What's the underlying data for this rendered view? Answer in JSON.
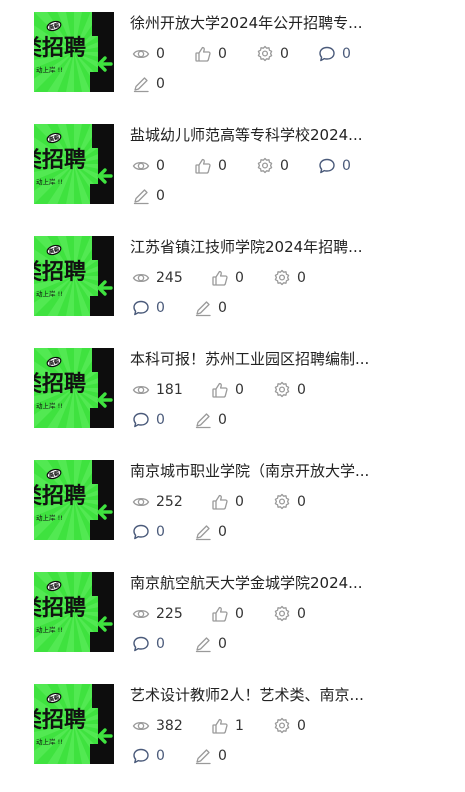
{
  "thumbnail": {
    "title_text": "类招聘",
    "sub_text": "动上岸 !!",
    "badge_text": "高薪",
    "colors": {
      "green": "#3fe23f",
      "dark": "#0d0d0d",
      "ray": "#63ee63"
    }
  },
  "icons": {
    "views": "eye-icon",
    "likes": "thumbs-up-icon",
    "favorites": "gear-star-icon",
    "comments": "comment-bubble-icon",
    "edits": "pencil-icon"
  },
  "colors": {
    "icon": "#9a9a9a",
    "comment_icon": "#4a5a7a",
    "text": "#333333"
  },
  "articles": [
    {
      "title": "徐州开放大学2024年公开招聘专...",
      "views": "0",
      "likes": "0",
      "favorites": "0",
      "comments": "0",
      "edits": "0"
    },
    {
      "title": "盐城幼儿师范高等专科学校2024...",
      "views": "0",
      "likes": "0",
      "favorites": "0",
      "comments": "0",
      "edits": "0"
    },
    {
      "title": "江苏省镇江技师学院2024年招聘...",
      "views": "245",
      "likes": "0",
      "favorites": "0",
      "comments": "0",
      "edits": "0"
    },
    {
      "title": "本科可报！苏州工业园区招聘编制...",
      "views": "181",
      "likes": "0",
      "favorites": "0",
      "comments": "0",
      "edits": "0"
    },
    {
      "title": "南京城市职业学院（南京开放大学...",
      "views": "252",
      "likes": "0",
      "favorites": "0",
      "comments": "0",
      "edits": "0"
    },
    {
      "title": "南京航空航天大学金城学院2024...",
      "views": "225",
      "likes": "0",
      "favorites": "0",
      "comments": "0",
      "edits": "0"
    },
    {
      "title": "艺术设计教师2人！艺术类、南京...",
      "views": "382",
      "likes": "1",
      "favorites": "0",
      "comments": "0",
      "edits": "0"
    }
  ]
}
